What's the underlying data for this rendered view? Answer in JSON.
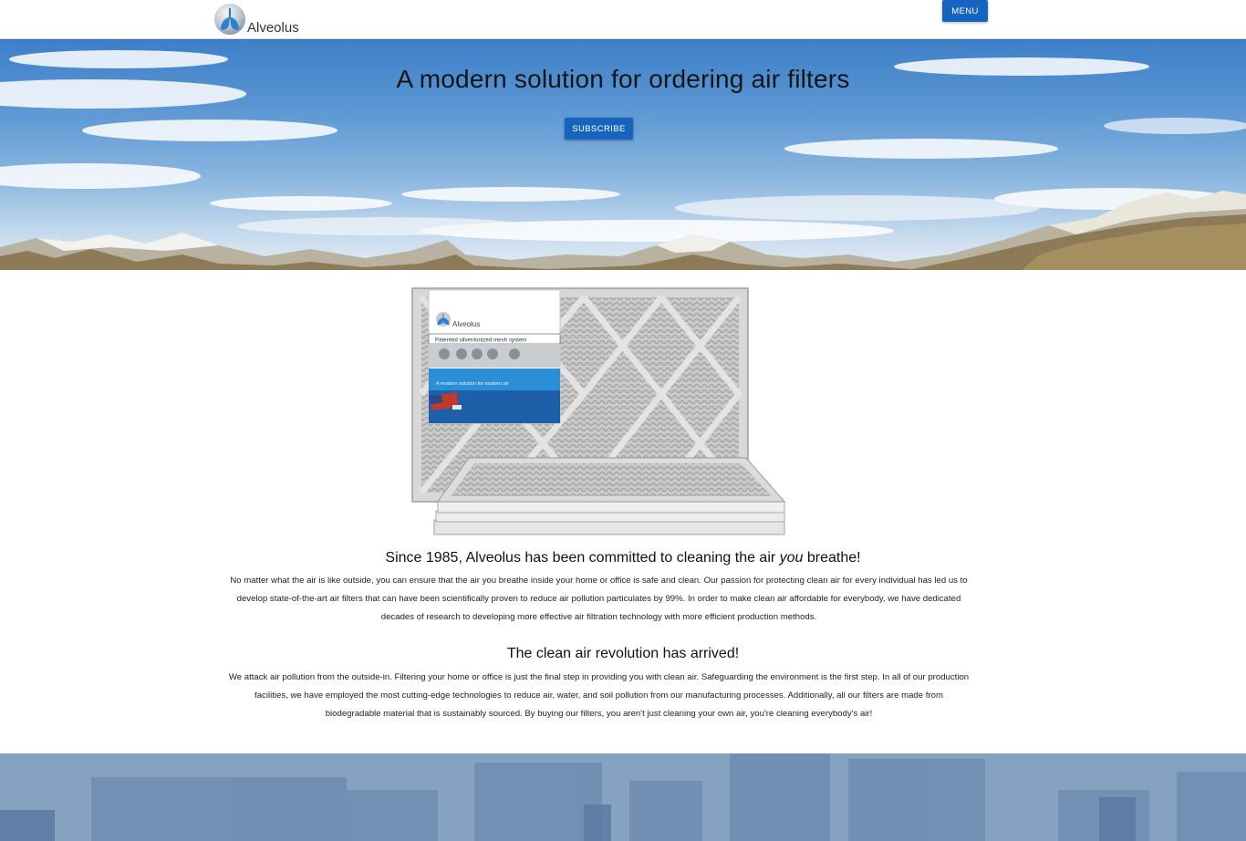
{
  "header": {
    "brand": "Alveolus",
    "menu_label": "MENU"
  },
  "hero": {
    "title": "A modern solution for ordering air filters",
    "subscribe_label": "SUBSCRIBE"
  },
  "product": {
    "package_brand": "Alveolus",
    "package_tagline": "Patented silver/ionized mesh system",
    "package_banner": "A modern solution for modern air"
  },
  "section1": {
    "heading_before": "Since 1985, Alveolus has been committed to cleaning the air ",
    "heading_em": "you",
    "heading_after": " breathe!",
    "body": "No matter what the air is like outside, you can ensure that the air you breathe inside your home or office is safe and clean. Our passion for protecting clean air for every individual has led us to develop state-of-the-art air filters that can have been scientifically proven to reduce air pollution particulates by 99%. In order to make clean air affordable for everybody, we have dedicated decades of research to developing more effective air filtration technology with more efficient production methods."
  },
  "section2": {
    "heading": "The clean air revolution has arrived!",
    "body": "We attack air pollution from the outside-in. Filtering your home or office is just the final step in providing you with clean air. Safeguarding the environment is the first step. In all of our production facilities, we have employed the most cutting-edge technologies to reduce air, water, and soil pollution from our manufacturing processes. Additionally, all our filters are made from biodegradable material that is sustainably sourced. By buying our filters, you aren't just cleaning your own air, you're cleaning everybody's air!"
  },
  "colors": {
    "primary_button": "#1565c0",
    "sky": "#5b96d3"
  },
  "icons": {
    "logo": "lungs-globe-icon"
  }
}
